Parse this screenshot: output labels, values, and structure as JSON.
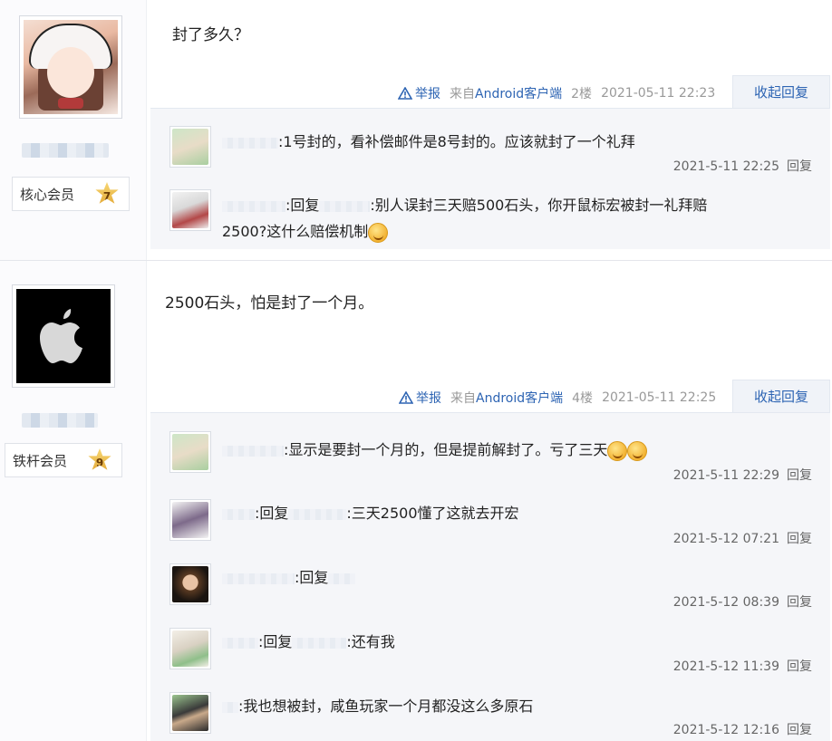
{
  "posts": [
    {
      "member_label": "核心会员",
      "level": "7",
      "content": "封了多久？",
      "tail": {
        "report": "举报",
        "from_prefix": "来自",
        "from_client": "Android客户端",
        "floor": "2楼",
        "time": "2021-05-11 22:23",
        "collapse": "收起回复"
      },
      "replies": [
        {
          "text": ":1号封的，看补偿邮件是8号封的。应该就封了一个礼拜",
          "time": "2021-5-11 22:25",
          "reply_btn": "回复"
        },
        {
          "prefix": ":回复",
          "text": ":别人误封三天赔500石头，你开鼠标宏被封一礼拜赔",
          "text2": "2500?这什么赔偿机制",
          "time": "",
          "reply_btn": ""
        }
      ]
    },
    {
      "member_label": "铁杆会员",
      "level": "9",
      "content": "2500石头，怕是封了一个月。",
      "tail": {
        "report": "举报",
        "from_prefix": "来自",
        "from_client": "Android客户端",
        "floor": "4楼",
        "time": "2021-05-11 22:25",
        "collapse": "收起回复"
      },
      "replies": [
        {
          "text": ":显示是要封一个月的，但是提前解封了。亏了三天",
          "time": "2021-5-11 22:29",
          "reply_btn": "回复"
        },
        {
          "prefix": ":回复",
          "text": ":三天2500懂了这就去开宏",
          "time": "2021-5-12 07:21",
          "reply_btn": "回复"
        },
        {
          "prefix": ":回复",
          "text": "",
          "time": "2021-5-12 08:39",
          "reply_btn": "回复"
        },
        {
          "prefix": ":回复",
          "text": ":还有我",
          "time": "2021-5-12 11:39",
          "reply_btn": "回复"
        },
        {
          "text": ":我也想被封，咸鱼玩家一个月都没这么多原石",
          "time": "2021-5-12 12:16",
          "reply_btn": "回复"
        }
      ]
    }
  ],
  "colors": {
    "link": "#2d64b3",
    "meta": "#999999",
    "subbox_bg": "#f5f6f9",
    "badge_star": "#e2a632"
  },
  "icons": {
    "report": "warning-triangle-icon",
    "emoji": "smiley-emoji-icon"
  }
}
